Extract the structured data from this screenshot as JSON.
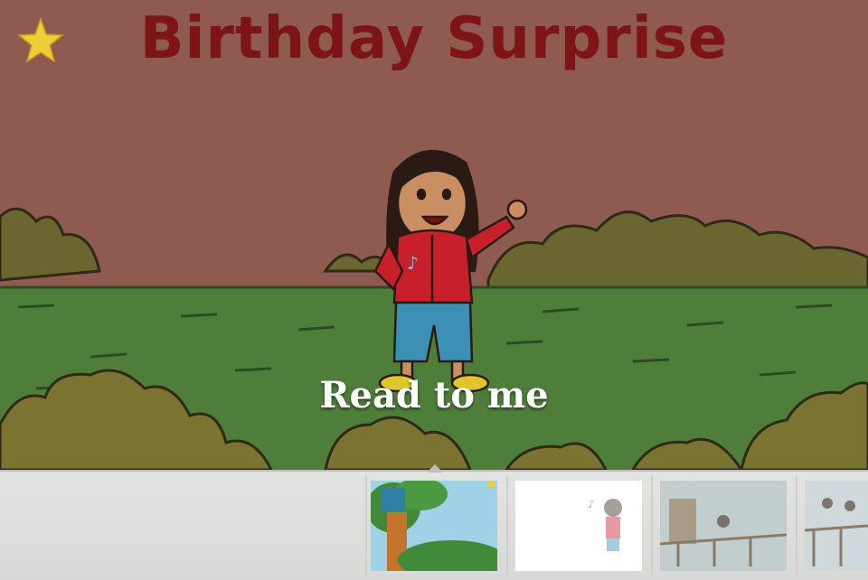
{
  "title": "Birthday Surprise",
  "read_button": {
    "label": "Read to me"
  },
  "favorite": {
    "icon": "star-icon"
  },
  "colors": {
    "sky": "#8f5a4f",
    "title": "#7c1418",
    "grass": "#4f7e3b",
    "bushes": "#6e6a2c",
    "jacket": "#c8202a",
    "pants": "#3c8fb5"
  },
  "pages": [
    {
      "thumb": "treehouse-thumbnail"
    },
    {
      "thumb": "girl-sketch-thumbnail"
    },
    {
      "thumb": "bridge-thumbnail"
    },
    {
      "thumb": "deck-thumbnail"
    }
  ]
}
